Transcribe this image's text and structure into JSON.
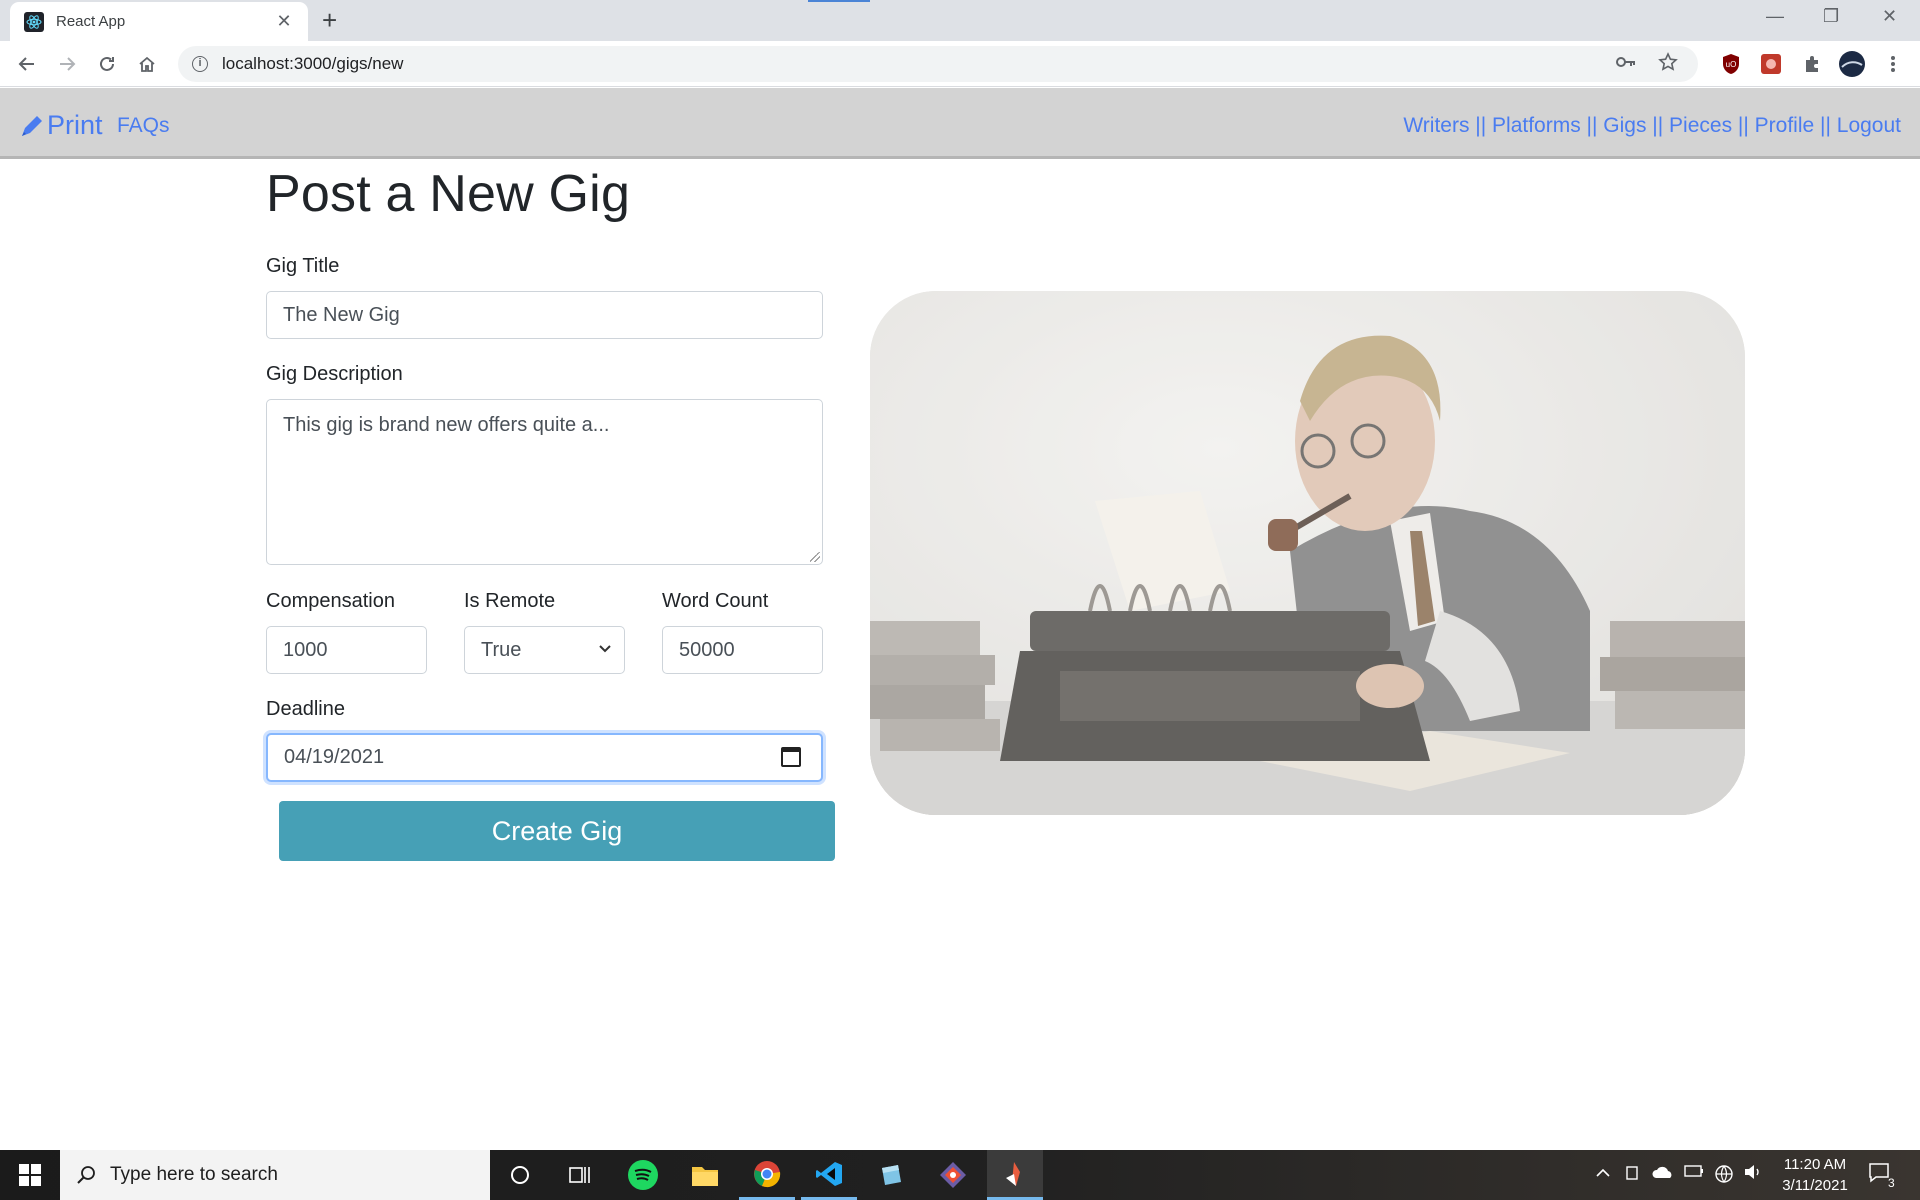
{
  "browser": {
    "tab_title": "React App",
    "tab_close": "✕",
    "new_tab": "+",
    "url": "localhost:3000/gigs/new",
    "window_controls": [
      "—",
      "❐",
      "✕"
    ]
  },
  "navbar": {
    "brand": "Print",
    "faq": "FAQs",
    "right_links": "Writers || Platforms || Gigs || Pieces || Profile || Logout",
    "link_color": "#4a7cf0",
    "background": "#d3d3d3"
  },
  "form": {
    "heading": "Post a New Gig",
    "title_label": "Gig Title",
    "title_value": "The New Gig",
    "description_label": "Gig Description",
    "description_value": "This gig is brand new offers quite a...",
    "compensation_label": "Compensation",
    "compensation_value": "1000",
    "remote_label": "Is Remote",
    "remote_value": "True",
    "wordcount_label": "Word Count",
    "wordcount_value": "50000",
    "deadline_label": "Deadline",
    "deadline_value": "04/19/2021",
    "submit_label": "Create Gig",
    "button_color": "#46a0b6"
  },
  "taskbar": {
    "search_placeholder": "Type here to search",
    "time": "11:20 AM",
    "date": "3/11/2021",
    "notification_count": "3"
  }
}
